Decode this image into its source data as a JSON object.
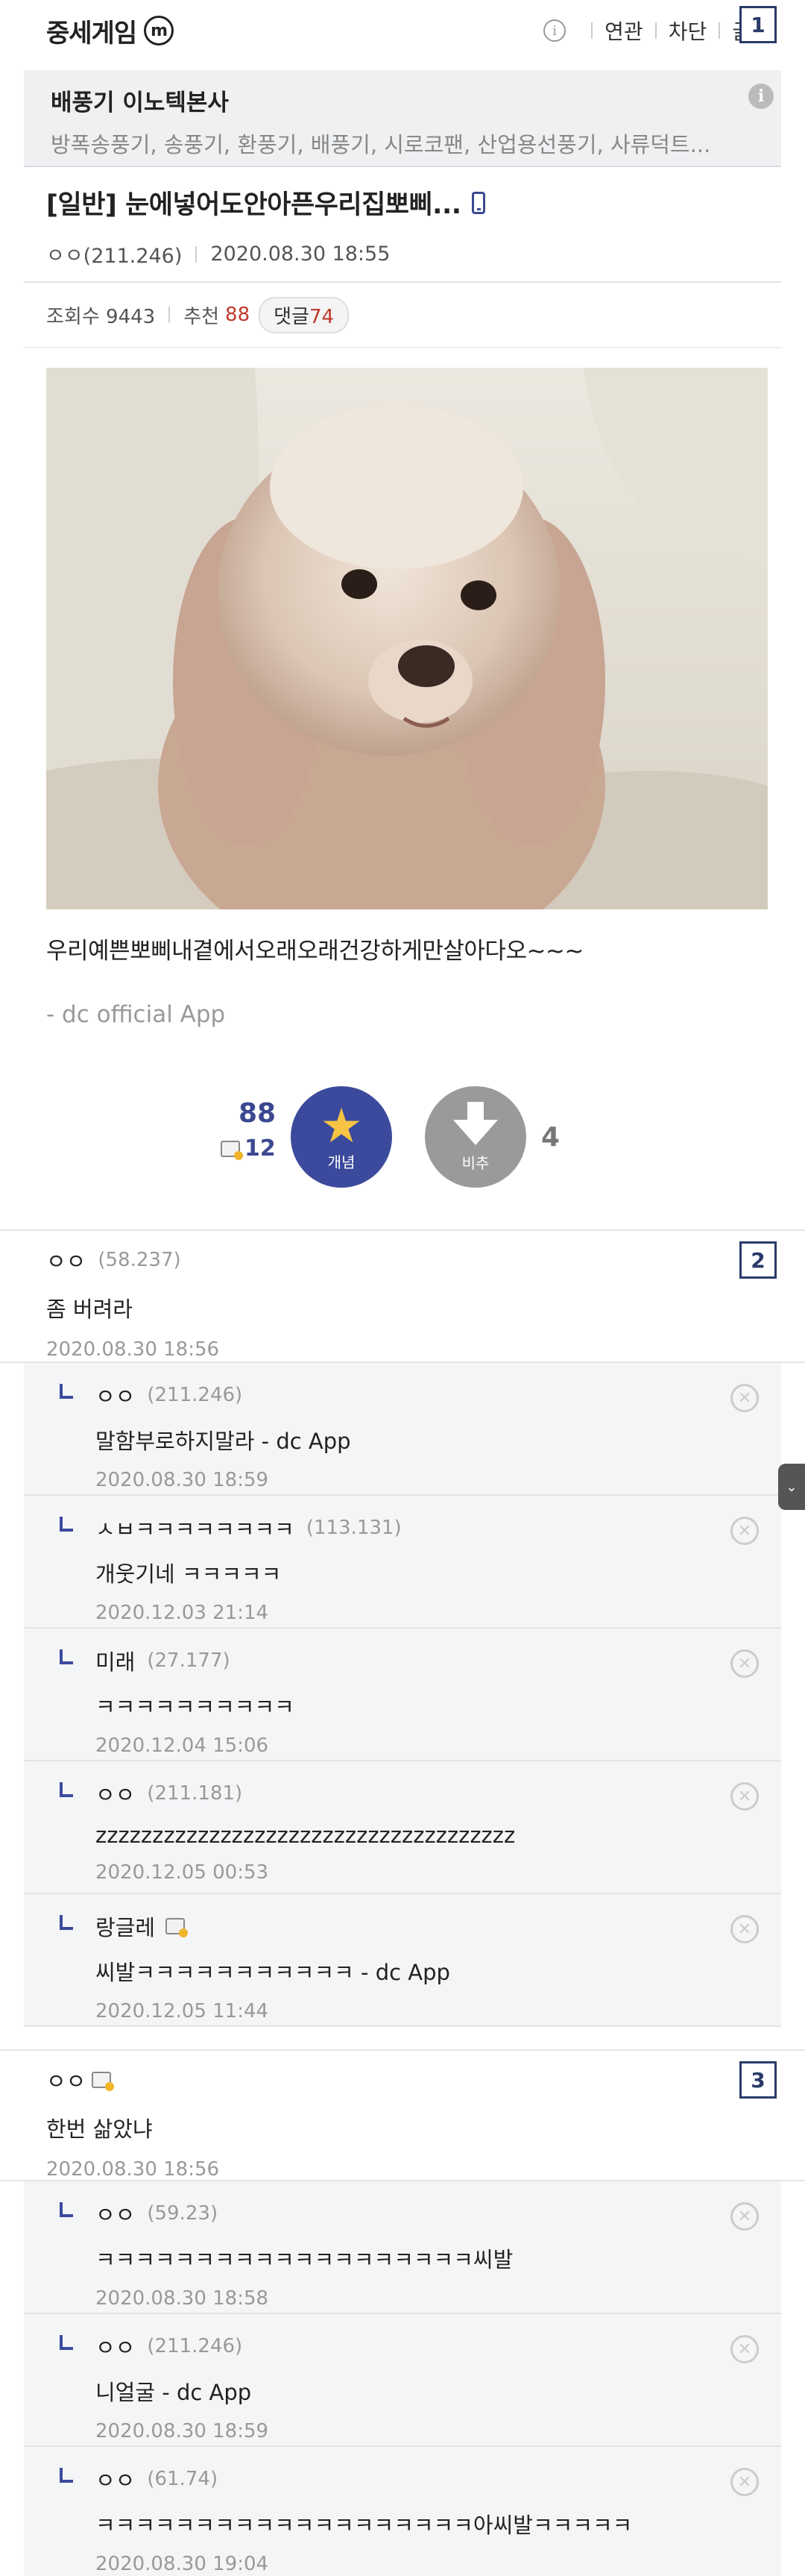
{
  "header": {
    "gallery_name": "중세게임",
    "gallery_badge": "m",
    "menu": [
      "연관",
      "차단",
      "글"
    ],
    "number_label": "1"
  },
  "ad": {
    "title": "배풍기 이노텍본사",
    "subtitle": "방폭송풍기, 송풍기, 환풍기, 배풍기, 시로코팬, 산업용선풍기, 사류덕트..."
  },
  "post": {
    "title": "[일반] 눈에넣어도안아픈우리집뽀삐...",
    "author": "ㅇㅇ(211.246)",
    "date": "2020.08.30 18:55",
    "views_label": "조회수 9443",
    "recommend_label": "추천",
    "recommend_count": "88",
    "reply_label": "댓글",
    "reply_count": "74",
    "body": "우리예쁜뽀삐내곁에서오래오래건강하게만살아다오~~~",
    "signature": "- dc official App"
  },
  "vote": {
    "up_count": "88",
    "fixed_count": "12",
    "up_label": "개념",
    "down_label": "비추",
    "down_count": "4"
  },
  "comments": [
    {
      "number_label": "2",
      "nick": "ㅇㅇ",
      "ip": "(58.237)",
      "text": "좀 버려라",
      "date": "2020.08.30 18:56",
      "replies": [
        {
          "nick": "ㅇㅇ",
          "ip": "(211.246)",
          "text": "말함부로하지말라 - dc App",
          "date": "2020.08.30 18:59"
        },
        {
          "nick": "ㅅㅂㅋㅋㅋㅋㅋㅋㅋㅋ",
          "ip": "(113.131)",
          "text": "개웃기네 ㅋㅋㅋㅋㅋ",
          "date": "2020.12.03 21:14"
        },
        {
          "nick": "미래",
          "ip": "(27.177)",
          "text": "ㅋㅋㅋㅋㅋㅋㅋㅋㅋㅋ",
          "date": "2020.12.04 15:06"
        },
        {
          "nick": "ㅇㅇ",
          "ip": "(211.181)",
          "text": "zzzzzzzzzzzzzzzzzzzzzzzzzzzzzzzzzzzzz",
          "date": "2020.12.05 00:53"
        },
        {
          "nick": "랑글레",
          "ip": "",
          "text": "씨발ㅋㅋㅋㅋㅋㅋㅋㅋㅋㅋㅋ - dc App",
          "date": "2020.12.05 11:44"
        }
      ]
    },
    {
      "number_label": "3",
      "nick": "ㅇㅇ",
      "ip": "",
      "text": "한번 삶았냐",
      "date": "2020.08.30 18:56",
      "replies": [
        {
          "nick": "ㅇㅇ",
          "ip": "(59.23)",
          "text": "ㅋㅋㅋㅋㅋㅋㅋㅋㅋㅋㅋㅋㅋㅋㅋㅋㅋㅋㅋ씨발",
          "date": "2020.08.30 18:58"
        },
        {
          "nick": "ㅇㅇ",
          "ip": "(211.246)",
          "text": "니얼굴 - dc App",
          "date": "2020.08.30 18:59"
        },
        {
          "nick": "ㅇㅇ",
          "ip": "(61.74)",
          "text": "ㅋㅋㅋㅋㅋㅋㅋㅋㅋㅋㅋㅋㅋㅋㅋㅋㅋㅋㅋ아씨발ㅋㅋㅋㅋㅋ",
          "date": "2020.08.30 19:04"
        }
      ]
    }
  ],
  "colors": {
    "accent": "#3b4a9c",
    "red": "#c0392b",
    "star": "#f6c342"
  }
}
